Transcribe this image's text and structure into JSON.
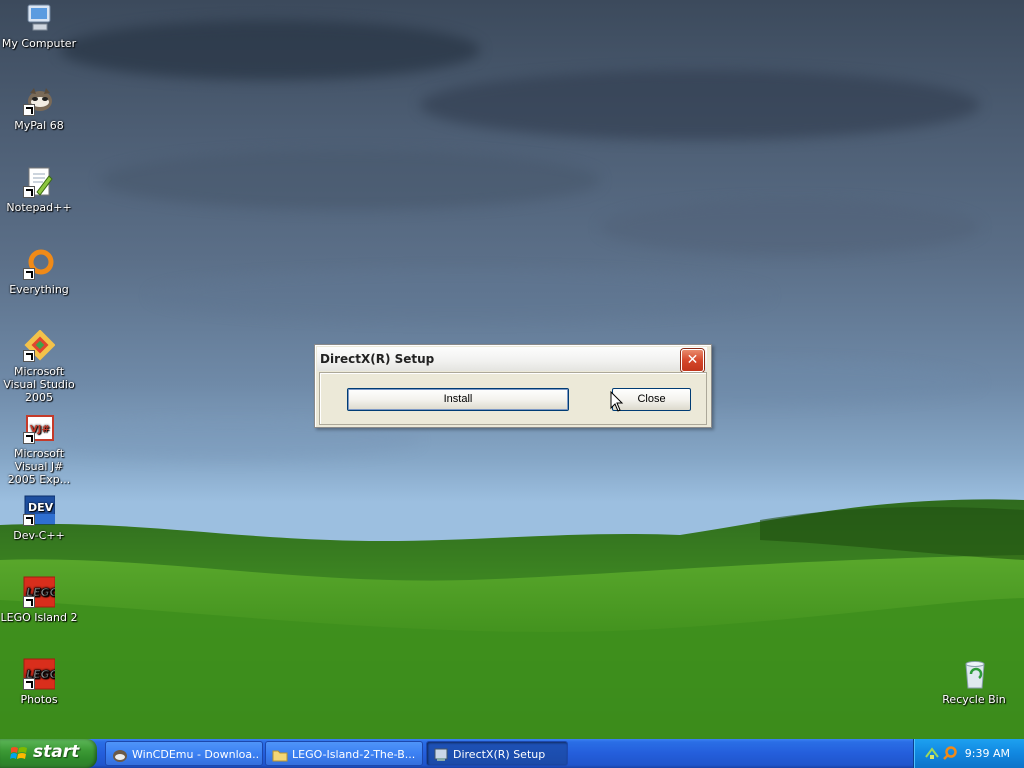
{
  "desktop": {
    "icons": [
      {
        "label": "My Computer",
        "icon": "computer-icon"
      },
      {
        "label": "MyPal 68",
        "icon": "mypal-icon"
      },
      {
        "label": "Notepad++",
        "icon": "notepadpp-icon"
      },
      {
        "label": "Everything",
        "icon": "everything-icon"
      },
      {
        "label": "Microsoft Visual Studio 2005",
        "icon": "visual-studio-icon"
      },
      {
        "label": "Microsoft Visual J# 2005 Exp...",
        "icon": "vjsharp-icon"
      },
      {
        "label": "Dev-C++",
        "icon": "devcpp-icon"
      },
      {
        "label": "LEGO Island 2",
        "icon": "lego-icon"
      },
      {
        "label": "Photos",
        "icon": "lego-icon"
      },
      {
        "label": "Recycle Bin",
        "icon": "recycle-bin-icon"
      }
    ],
    "lego_logo_text": "LEGO",
    "dev_logo_text": "DEV",
    "vj_logo_text": "VJ#"
  },
  "dialog": {
    "title": "DirectX(R) Setup",
    "install_label": "Install",
    "close_label": "Close",
    "close_glyph": "✕"
  },
  "taskbar": {
    "start_label": "start",
    "tasks": [
      {
        "label": "WinCDEmu - Downloa...",
        "icon": "browser-icon",
        "active": false
      },
      {
        "label": "LEGO-Island-2-The-B...",
        "icon": "folder-icon",
        "active": false
      },
      {
        "label": "DirectX(R) Setup",
        "icon": "setup-icon",
        "active": true
      }
    ],
    "clock": "9:39 AM"
  },
  "colors": {
    "taskbar_blue": "#245edb",
    "start_green": "#3c9a35",
    "dialog_bg": "#ece9d8",
    "close_red": "#d5472b"
  }
}
